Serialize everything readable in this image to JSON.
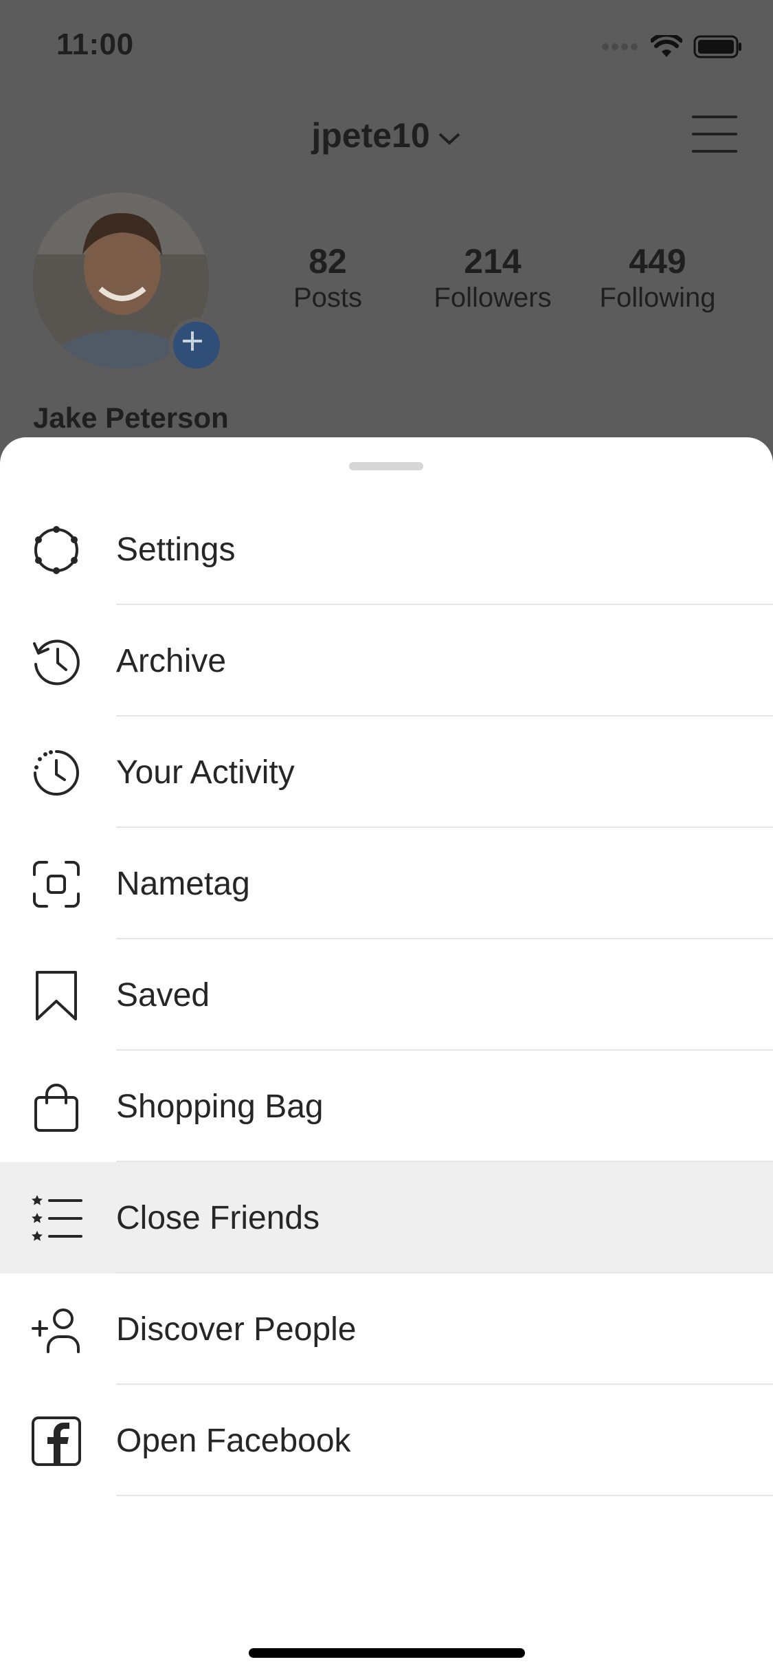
{
  "status_bar": {
    "time": "11:00"
  },
  "profile": {
    "username": "jpete10",
    "full_name": "Jake Peterson",
    "stats": [
      {
        "value": "82",
        "label": "Posts"
      },
      {
        "value": "214",
        "label": "Followers"
      },
      {
        "value": "449",
        "label": "Following"
      }
    ]
  },
  "menu": {
    "items": [
      {
        "label": "Settings",
        "icon": "settings-gear-icon"
      },
      {
        "label": "Archive",
        "icon": "archive-history-icon"
      },
      {
        "label": "Your Activity",
        "icon": "activity-clock-icon"
      },
      {
        "label": "Nametag",
        "icon": "nametag-scan-icon"
      },
      {
        "label": "Saved",
        "icon": "bookmark-icon"
      },
      {
        "label": "Shopping Bag",
        "icon": "shopping-bag-icon"
      },
      {
        "label": "Close Friends",
        "icon": "close-friends-list-icon",
        "highlighted": true
      },
      {
        "label": "Discover People",
        "icon": "add-person-icon"
      },
      {
        "label": "Open Facebook",
        "icon": "facebook-icon"
      }
    ]
  },
  "colors": {
    "overlay_bg": "#5c5c5c",
    "sheet_bg": "#ffffff",
    "highlight_bg": "#efefef",
    "text": "#262626"
  }
}
